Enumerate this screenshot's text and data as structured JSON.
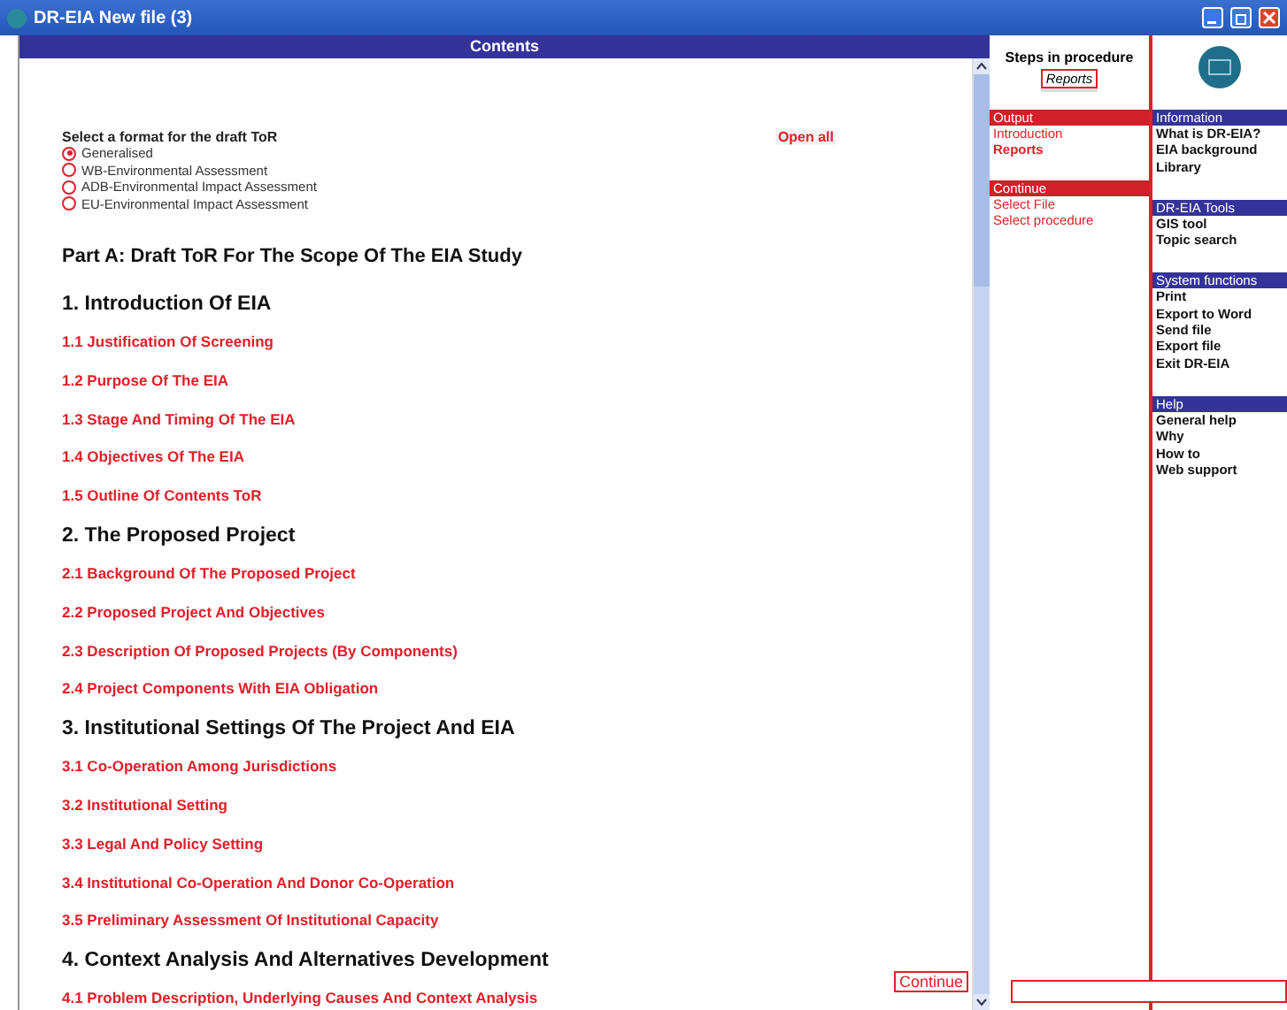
{
  "window": {
    "title": "DR-EIA New file (3)"
  },
  "contents": {
    "title": "Contents",
    "format_prompt": "Select a format for the draft ToR",
    "open_all": "Open all",
    "formats": [
      {
        "label": "Generalised",
        "selected": true
      },
      {
        "label": "WB-Environmental Assessment",
        "selected": false
      },
      {
        "label": "ADB-Environmental Impact Assessment",
        "selected": false
      },
      {
        "label": "EU-Environmental Impact Assessment",
        "selected": false
      }
    ],
    "part_title": "Part A: Draft ToR For The Scope Of The EIA Study",
    "sections": [
      {
        "title": "1. Introduction Of EIA",
        "items": [
          "1.1 Justification Of Screening",
          "1.2 Purpose Of The EIA",
          "1.3 Stage And Timing Of The EIA",
          "1.4 Objectives Of The EIA",
          "1.5 Outline Of Contents ToR"
        ]
      },
      {
        "title": "2. The Proposed Project",
        "items": [
          "2.1 Background Of The Proposed Project",
          "2.2 Proposed Project And Objectives",
          "2.3 Description Of Proposed Projects (By Components)",
          "2.4 Project Components With EIA Obligation"
        ]
      },
      {
        "title": "3. Institutional Settings Of The Project And EIA",
        "items": [
          "3.1 Co-Operation Among Jurisdictions",
          "3.2 Institutional Setting",
          "3.3 Legal And Policy Setting",
          "3.4 Institutional Co-Operation And Donor Co-Operation",
          "3.5 Preliminary Assessment Of Institutional Capacity"
        ]
      },
      {
        "title": "4. Context Analysis And Alternatives Development",
        "items": [
          "4.1 Problem Description, Underlying Causes And Context Analysis"
        ]
      }
    ],
    "continue_button": "Continue"
  },
  "steps": {
    "title": "Steps in procedure",
    "current": "Reports",
    "groups": [
      {
        "header": "Output",
        "items": [
          {
            "label": "Introduction",
            "selected": false
          },
          {
            "label": "Reports",
            "selected": true
          }
        ]
      },
      {
        "header": "Continue",
        "items": [
          {
            "label": "Select File",
            "selected": false
          },
          {
            "label": "Select procedure",
            "selected": false
          }
        ]
      }
    ]
  },
  "menu": {
    "groups": [
      {
        "header": "Information",
        "items": [
          "What is DR-EIA?",
          "EIA background",
          "Library"
        ]
      },
      {
        "header": "DR-EIA Tools",
        "items": [
          "GIS tool",
          "Topic search"
        ]
      },
      {
        "header": "System functions",
        "items": [
          "Print",
          "Export to Word",
          "Send file",
          "Export file",
          "Exit DR-EIA"
        ]
      },
      {
        "header": "Help",
        "items": [
          "General help",
          "Why",
          "How to",
          "Web support"
        ]
      }
    ]
  }
}
